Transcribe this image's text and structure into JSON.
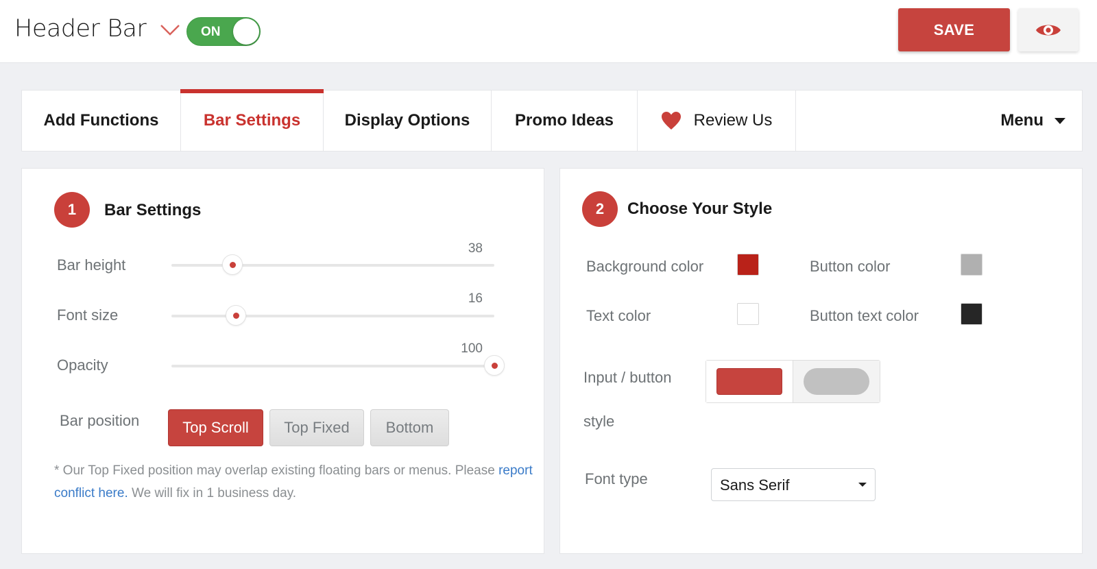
{
  "header": {
    "title": "Header Bar",
    "toggle_label": "ON",
    "toggle_on": true,
    "save_label": "SAVE",
    "preview_icon": "eye-icon"
  },
  "tabs": [
    {
      "label": "Add Functions",
      "active": false
    },
    {
      "label": "Bar Settings",
      "active": true
    },
    {
      "label": "Display Options",
      "active": false
    },
    {
      "label": "Promo Ideas",
      "active": false
    },
    {
      "label": "Review Us",
      "active": false,
      "icon": "heart-icon"
    },
    {
      "label": "Menu",
      "active": false,
      "icon": "caret-down-icon"
    }
  ],
  "bar_settings": {
    "step": "1",
    "title": "Bar Settings",
    "sliders": [
      {
        "label": "Bar height",
        "value": "38",
        "fill_fraction": 0.19
      },
      {
        "label": "Font size",
        "value": "16",
        "fill_fraction": 0.2
      },
      {
        "label": "Opacity",
        "value": "100",
        "fill_fraction": 1.0
      }
    ],
    "position": {
      "label": "Bar position",
      "options": [
        "Top Scroll",
        "Top Fixed",
        "Bottom"
      ],
      "selected": "Top Scroll"
    },
    "note": {
      "text_before": "* Our Top Fixed position may overlap existing floating bars or menus. Please ",
      "link": "report conflict here.",
      "text_after": " We will fix in 1 business day."
    }
  },
  "style": {
    "step": "2",
    "title": "Choose Your Style",
    "colors": [
      {
        "label": "Background color",
        "value": "#b92219"
      },
      {
        "label": "Button color",
        "value": "#b0b0b0"
      },
      {
        "label": "Text color",
        "value": "#ffffff"
      },
      {
        "label": "Button text color",
        "value": "#262626"
      }
    ],
    "input_style": {
      "label_line1": "Input / button",
      "label_line2": "style",
      "options": [
        "rectangle",
        "pill"
      ],
      "selected": "rectangle"
    },
    "font_type": {
      "label": "Font type",
      "value": "Sans Serif"
    }
  },
  "theme": {
    "accent": "#c9403a",
    "toggle_green": "#4aa74e",
    "link_blue": "#3a7bc8"
  }
}
